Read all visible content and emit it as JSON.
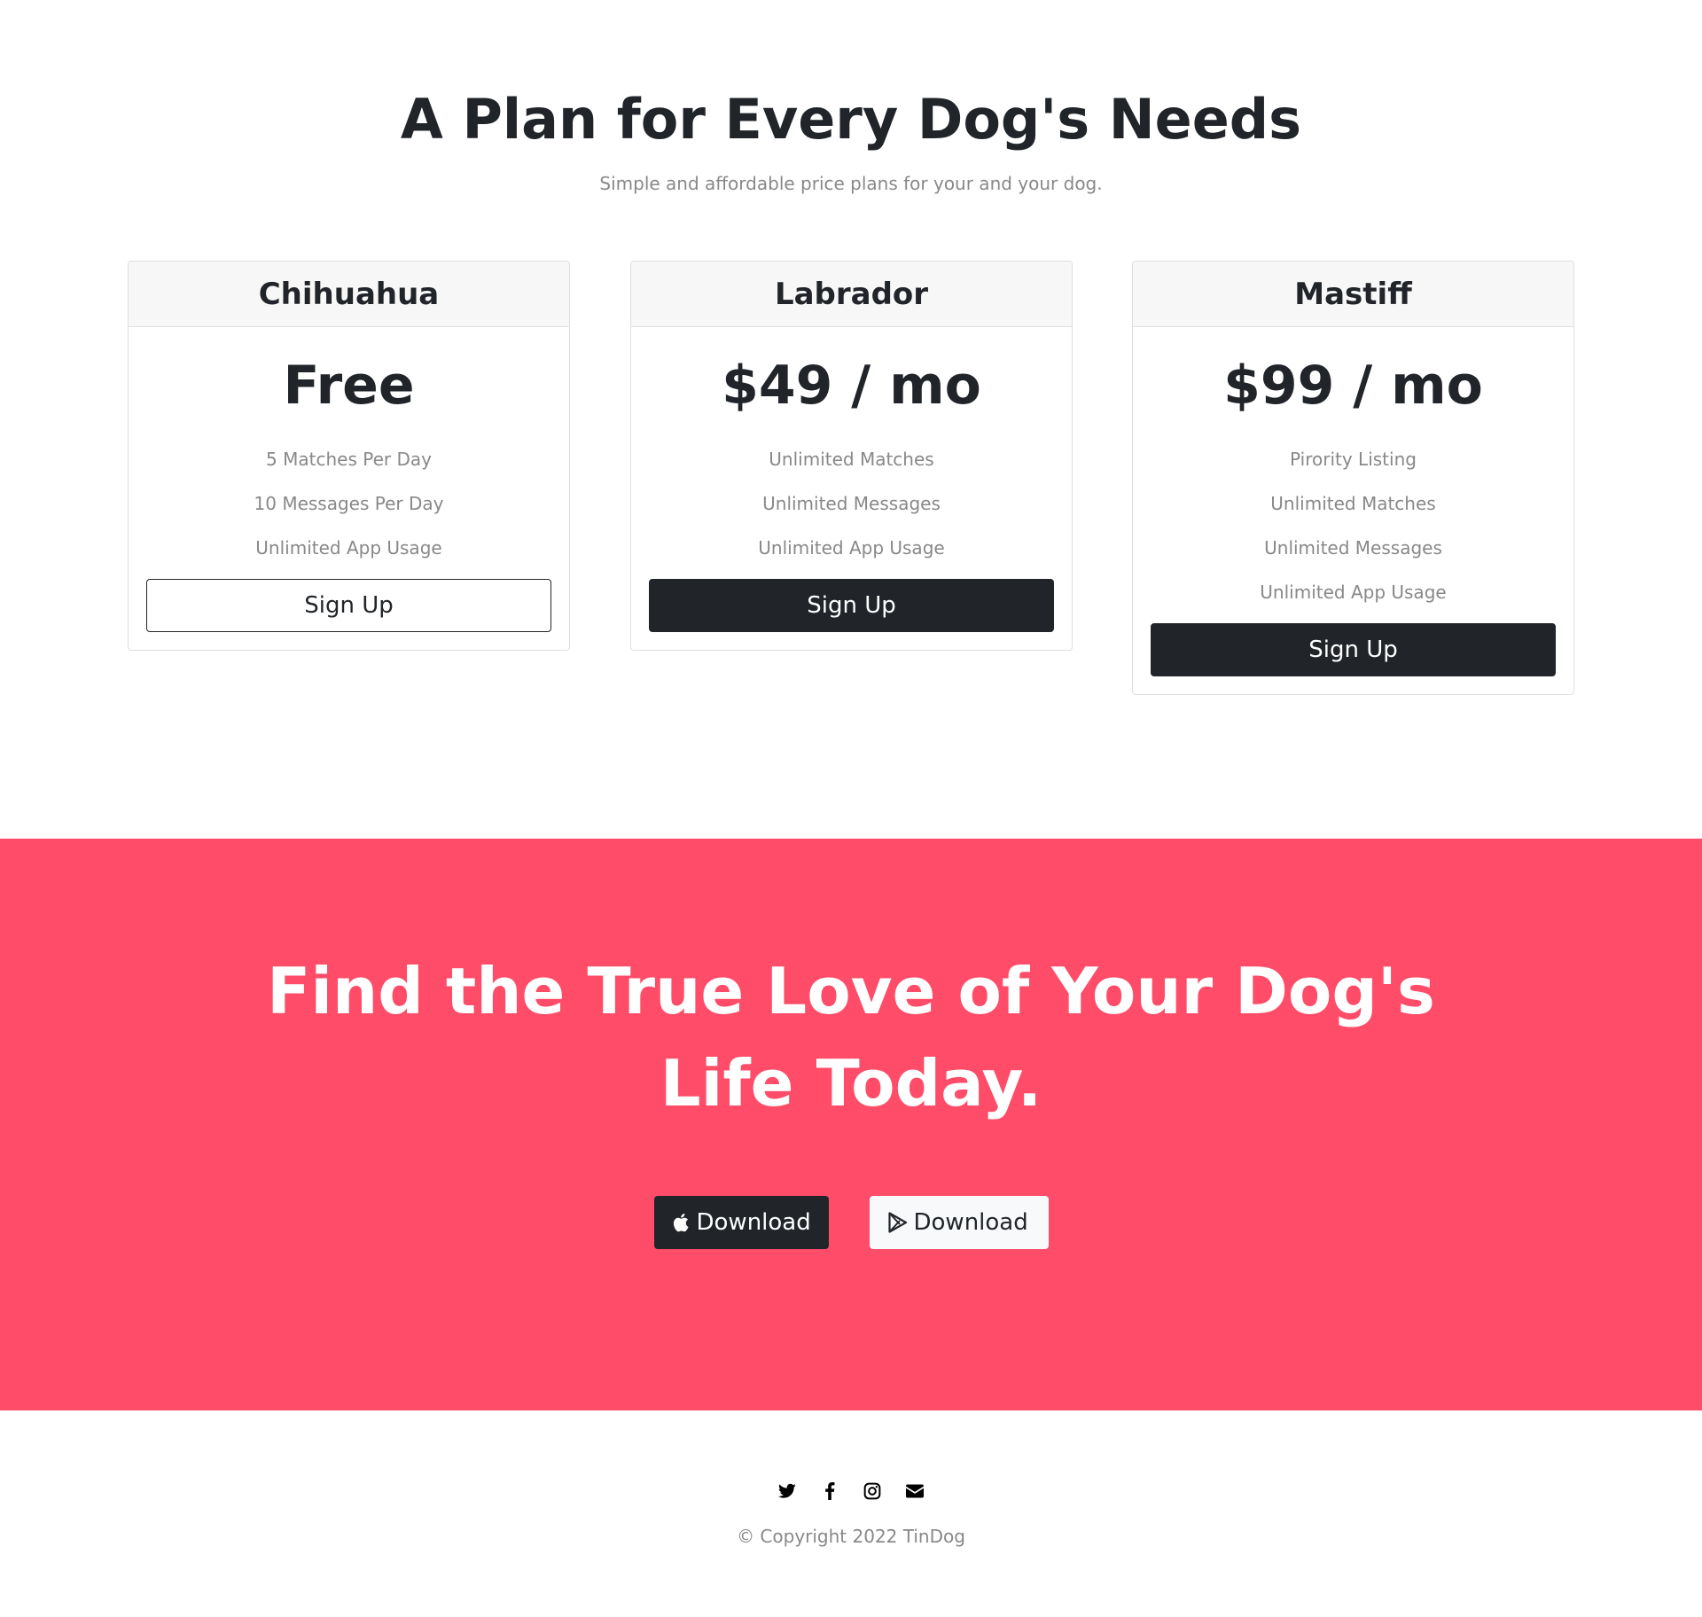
{
  "pricing": {
    "title": "A Plan for Every Dog's Needs",
    "subtitle": "Simple and affordable price plans for your and your dog.",
    "plans": [
      {
        "name": "Chihuahua",
        "price": "Free",
        "features": [
          "5 Matches Per Day",
          "10 Messages Per Day",
          "Unlimited App Usage"
        ],
        "button": "Sign Up"
      },
      {
        "name": "Labrador",
        "price": "$49 / mo",
        "features": [
          "Unlimited Matches",
          "Unlimited Messages",
          "Unlimited App Usage"
        ],
        "button": "Sign Up"
      },
      {
        "name": "Mastiff",
        "price": "$99 / mo",
        "features": [
          "Pirority Listing",
          "Unlimited Matches",
          "Unlimited Messages",
          "Unlimited App Usage"
        ],
        "button": "Sign Up"
      }
    ]
  },
  "cta": {
    "title": "Find the True Love of Your Dog's Life Today.",
    "apple_button": "Download",
    "google_button": "Download",
    "background_color": "#ff4c68"
  },
  "footer": {
    "social_icons": [
      "twitter-icon",
      "facebook-icon",
      "instagram-icon",
      "envelope-icon"
    ],
    "copyright": "© Copyright 2022 TinDog"
  }
}
